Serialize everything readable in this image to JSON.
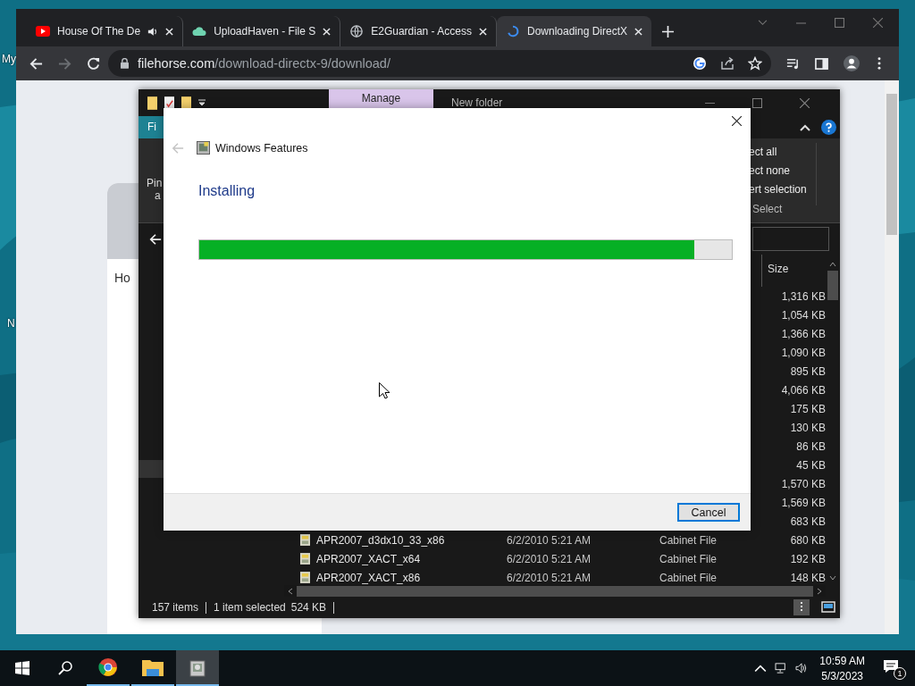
{
  "desktop": {
    "icon_labels": [
      "My",
      "N"
    ]
  },
  "browser": {
    "tabs": [
      {
        "title": "House Of The De",
        "kind": "video",
        "audio": true,
        "selected": false
      },
      {
        "title": "UploadHaven - File S",
        "kind": "cloud",
        "audio": false,
        "selected": false
      },
      {
        "title": "E2Guardian - Access",
        "kind": "globe",
        "audio": false,
        "selected": false
      },
      {
        "title": "Downloading DirectX",
        "kind": "loader",
        "audio": false,
        "selected": true
      }
    ],
    "url_host": "filehorse.com",
    "url_path": "/download-directx-9/download/",
    "card_text": "Ho"
  },
  "explorer": {
    "title": "New folder",
    "context_tab": "Manage",
    "file_tab": "Fi",
    "ribbon_left": [
      "Pin",
      "a"
    ],
    "select_commands": [
      "ect all",
      "ect none",
      "ert selection"
    ],
    "select_group": "Select",
    "size_header": "Size",
    "rows": [
      {
        "size": "1,316 KB"
      },
      {
        "size": "1,054 KB"
      },
      {
        "size": "1,366 KB"
      },
      {
        "size": "1,090 KB"
      },
      {
        "size": "895 KB"
      },
      {
        "size": "4,066 KB"
      },
      {
        "size": "175 KB"
      },
      {
        "size": "130 KB"
      },
      {
        "size": "86 KB"
      },
      {
        "size": "45 KB"
      },
      {
        "size": "1,570 KB"
      },
      {
        "size": "1,569 KB"
      },
      {
        "size": "683 KB"
      },
      {
        "name": "APR2007_d3dx10_33_x86",
        "date": "6/2/2010 5:21 AM",
        "type": "Cabinet File",
        "size": "680 KB"
      },
      {
        "name": "APR2007_XACT_x64",
        "date": "6/2/2010 5:21 AM",
        "type": "Cabinet File",
        "size": "192 KB"
      },
      {
        "name": "APR2007_XACT_x86",
        "date": "6/2/2010 5:21 AM",
        "type": "Cabinet File",
        "size": "148 KB"
      }
    ],
    "status": {
      "count": "157 items",
      "selection": "1 item selected",
      "selection_size": "524 KB"
    }
  },
  "dialog": {
    "title": "Windows Features",
    "heading": "Installing",
    "progress": {
      "level": 0.93
    },
    "button": "Cancel"
  },
  "taskbar": {
    "apps": [
      {
        "kind": "chrome",
        "selected": false
      },
      {
        "kind": "folder",
        "selected": false
      },
      {
        "kind": "features",
        "selected": true
      }
    ],
    "time": "10:59 AM",
    "date": "5/3/2023",
    "notifications": "1"
  }
}
